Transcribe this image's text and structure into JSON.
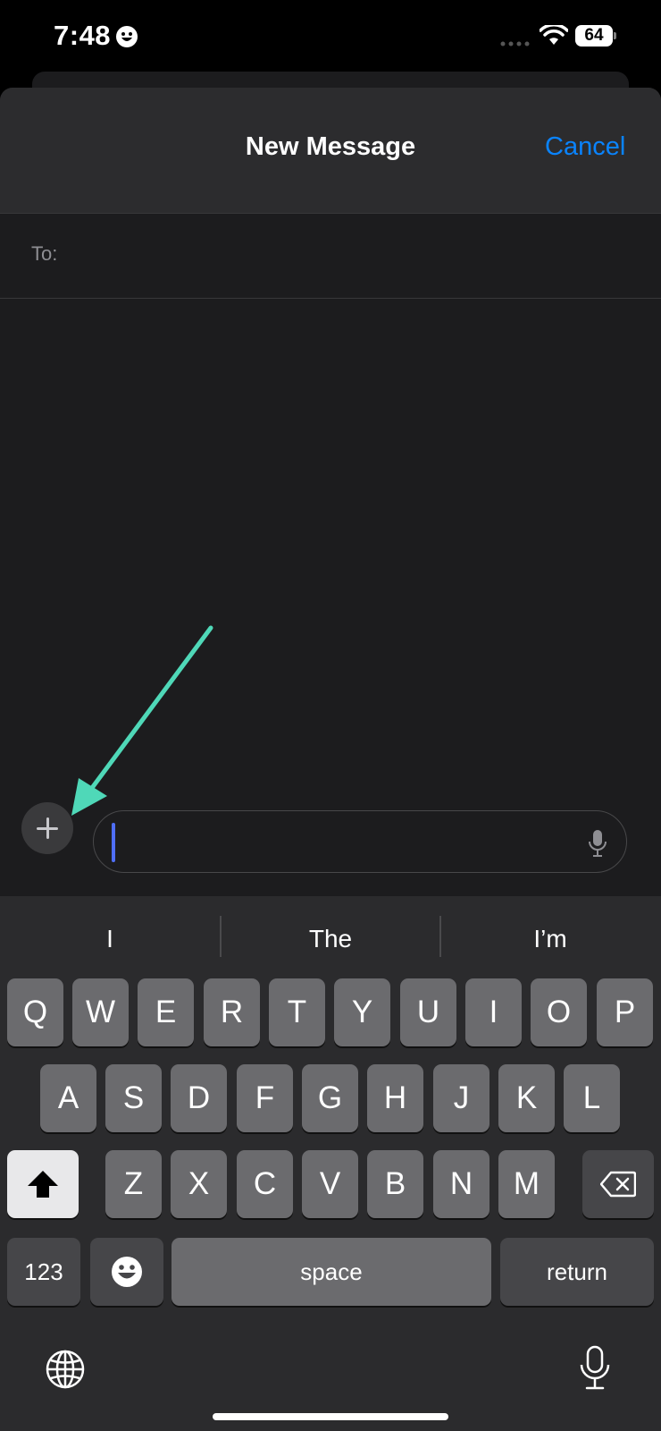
{
  "status_bar": {
    "time": "7:48",
    "battery": "64"
  },
  "header": {
    "title": "New Message",
    "cancel_label": "Cancel"
  },
  "recipient": {
    "label": "To:"
  },
  "message_input": {
    "value": ""
  },
  "keyboard": {
    "suggestions": [
      "I",
      "The",
      "I’m"
    ],
    "row1": [
      "Q",
      "W",
      "E",
      "R",
      "T",
      "Y",
      "U",
      "I",
      "O",
      "P"
    ],
    "row2": [
      "A",
      "S",
      "D",
      "F",
      "G",
      "H",
      "J",
      "K",
      "L"
    ],
    "row3": [
      "Z",
      "X",
      "C",
      "V",
      "B",
      "N",
      "M"
    ],
    "numbers_label": "123",
    "space_label": "space",
    "return_label": "return"
  },
  "colors": {
    "accent": "#0a84ff",
    "annotation_arrow": "#4fd8b8",
    "caret": "#4f6ef7"
  }
}
